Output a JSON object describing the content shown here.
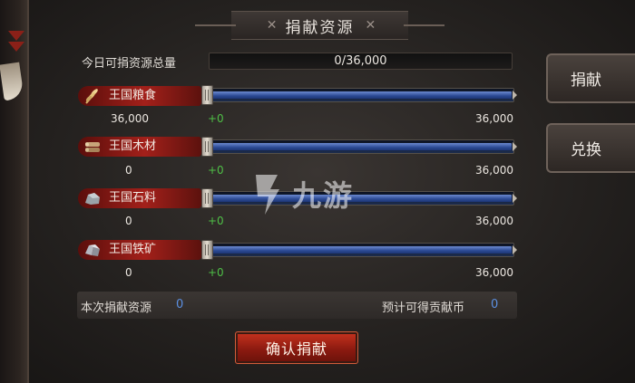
{
  "panel": {
    "title": "捐献资源"
  },
  "total": {
    "label": "今日可捐资源总量",
    "value": "0/36,000"
  },
  "resources": [
    {
      "name": "王国粮食",
      "icon": "wheat-icon",
      "amount": "36,000",
      "add": "+0",
      "max": "36,000",
      "slider_fraction": 0.0
    },
    {
      "name": "王国木材",
      "icon": "wood-icon",
      "amount": "0",
      "add": "+0",
      "max": "36,000",
      "slider_fraction": 0.0
    },
    {
      "name": "王国石料",
      "icon": "stone-icon",
      "amount": "0",
      "add": "+0",
      "max": "36,000",
      "slider_fraction": 0.0
    },
    {
      "name": "王国铁矿",
      "icon": "iron-ore-icon",
      "amount": "0",
      "add": "+0",
      "max": "36,000",
      "slider_fraction": 0.0
    }
  ],
  "side_buttons": {
    "donate": "捐献",
    "exchange": "兑换"
  },
  "summary": {
    "donate_label": "本次捐献资源",
    "donate_value": "0",
    "expected_label": "预计可得贡献币",
    "expected_value": "0"
  },
  "confirm_label": "确认捐献",
  "watermark": {
    "text": "九游"
  },
  "colors": {
    "accent_red": "#a3201a",
    "slider_blue": "#2c4a94",
    "gain_green": "#4fbf47",
    "value_blue": "#5b8fe0"
  }
}
